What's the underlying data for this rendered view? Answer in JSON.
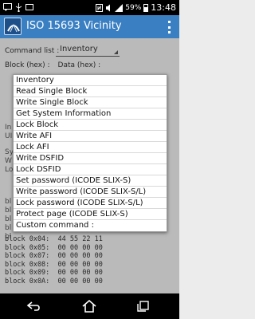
{
  "status_bar": {
    "battery_percent": "59%",
    "time": "13:48"
  },
  "app": {
    "title": "ISO 15693 Vicinity"
  },
  "form": {
    "command_label": "Command list :",
    "command_value": "Inventory",
    "block_label": "Block (hex) :",
    "data_label": "Data (hex) :"
  },
  "side_fragments": [
    "In",
    "UI",
    "Sy",
    "W",
    "Lo",
    "bl",
    "bl",
    "bl",
    "bl",
    "bl"
  ],
  "blocks": [
    "block 0x04:  44 55 22 11",
    "block 0x05:  00 00 00 00",
    "block 0x07:  00 00 00 00",
    "block 0x08:  00 00 00 00",
    "block 0x09:  00 00 00 00",
    "block 0x0A:  00 00 00 00"
  ],
  "menu": {
    "items": [
      "Inventory",
      "Read Single Block",
      "Write Single Block",
      "Get System Information",
      "Lock Block",
      "Write AFI",
      "Lock AFI",
      "Write DSFID",
      "Lock DSFID",
      "Set password (ICODE SLIX-S)",
      "Write password (ICODE SLIX-S/L)",
      "Lock password (ICODE SLIX-S/L)",
      "Protect page (ICODE SLIX-S)",
      "Custom command :"
    ]
  }
}
